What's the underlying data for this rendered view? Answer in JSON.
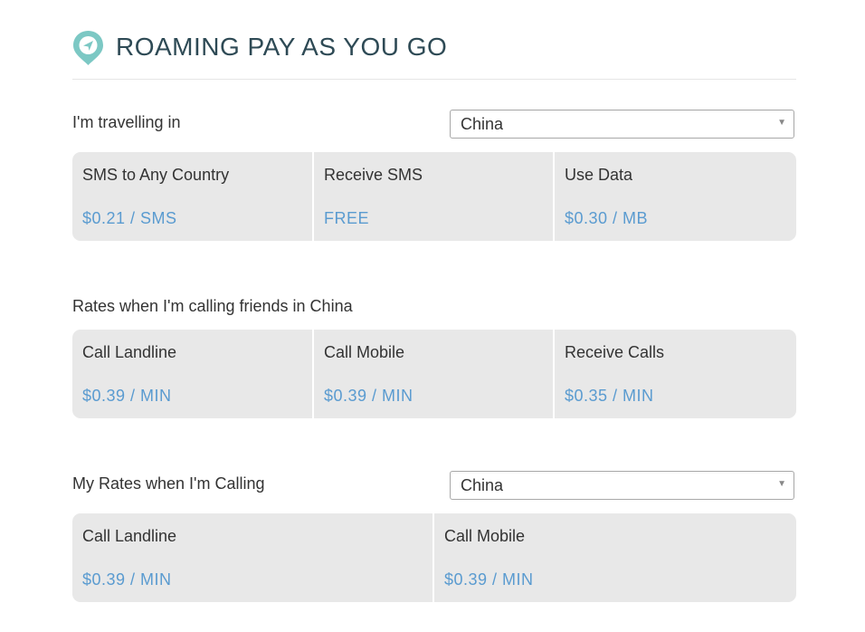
{
  "header": {
    "title": "ROAMING PAY AS YOU GO",
    "icon": "location-pin-icon",
    "accent": "#7cc8c4"
  },
  "travel": {
    "label": "I'm travelling in",
    "country": "China",
    "rates": [
      {
        "name": "SMS to Any Country",
        "price": "$0.21 / SMS"
      },
      {
        "name": "Receive SMS",
        "price": "FREE"
      },
      {
        "name": "Use Data",
        "price": "$0.30 / MB"
      }
    ]
  },
  "friends": {
    "label": "Rates when I'm calling friends in China",
    "rates": [
      {
        "name": "Call Landline",
        "price": "$0.39 / MIN"
      },
      {
        "name": "Call Mobile",
        "price": "$0.39 / MIN"
      },
      {
        "name": "Receive Calls",
        "price": "$0.35 / MIN"
      }
    ]
  },
  "my_rates": {
    "label": "My Rates when I'm Calling",
    "country": "China",
    "rates": [
      {
        "name": "Call Landline",
        "price": "$0.39 / MIN"
      },
      {
        "name": "Call Mobile",
        "price": "$0.39 / MIN"
      }
    ]
  },
  "colors": {
    "price": "#5a9bd0",
    "card_bg": "#e8e8e8"
  }
}
